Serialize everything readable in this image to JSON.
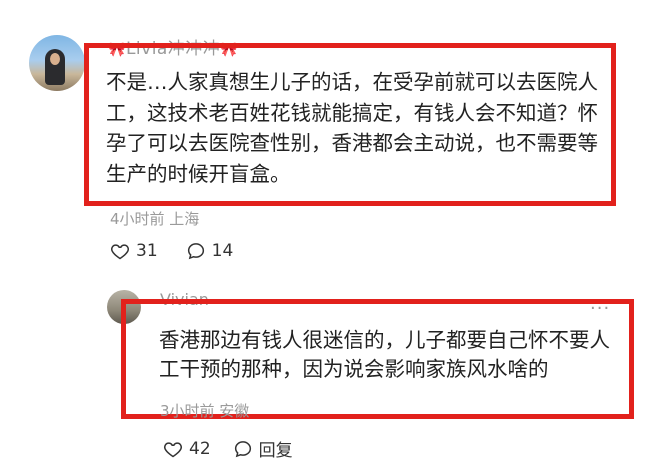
{
  "comment": {
    "username": "Livia冲冲冲",
    "text": "不是…人家真想生儿子的话，在受孕前就可以去医院人工，这技术老百姓花钱就能搞定，有钱人会不知道？怀孕了可以去医院查性别，香港都会主动说，也不需要等生产的时候开盲盒。",
    "meta": "4小时前 上海",
    "likes": "31",
    "comments": "14",
    "heart_icon": "heart-outline-icon",
    "comment_icon": "speech-bubble-icon"
  },
  "reply": {
    "username": "Vivian",
    "text": "香港那边有钱人很迷信的，儿子都要自己怀不要人工干预的那种，因为说会影响家族风水啥的",
    "meta": "3小时前 安徽",
    "likes": "42",
    "reply_label": "回复",
    "more": "···"
  },
  "colors": {
    "highlight_border": "#e2211c",
    "meta_text": "#9a9a9a"
  }
}
